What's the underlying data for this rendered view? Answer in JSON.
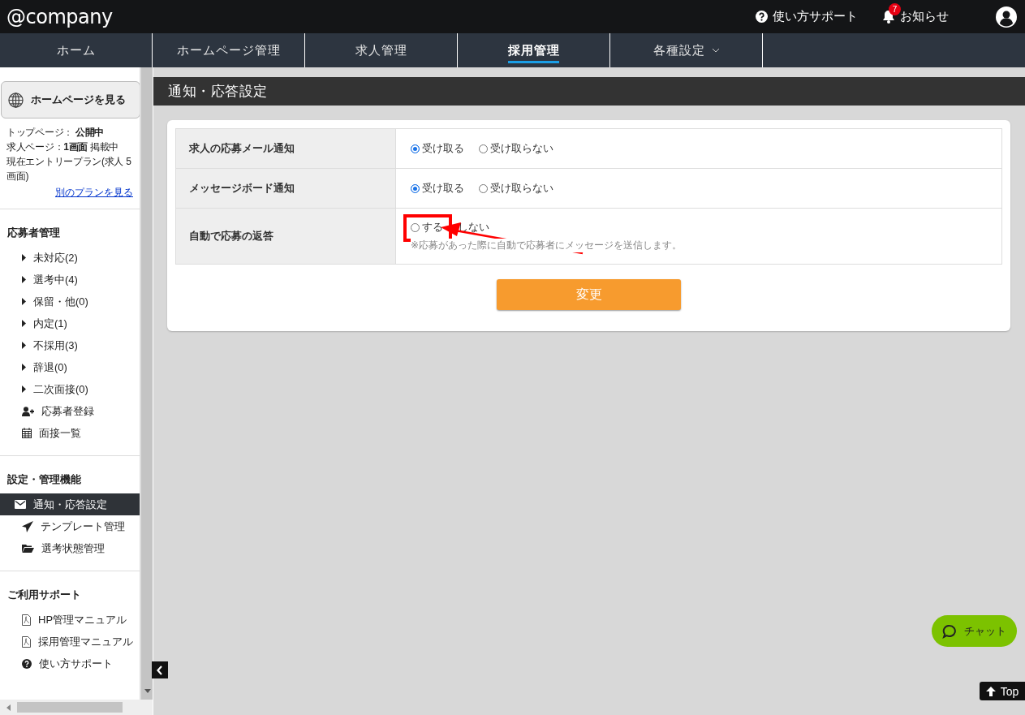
{
  "header": {
    "logo": "@company",
    "support": "使い方サポート",
    "notifications": {
      "label": "お知らせ",
      "badge": "7"
    }
  },
  "nav": [
    {
      "label": "ホーム",
      "selected": false,
      "dropdown": false
    },
    {
      "label": "ホームページ管理",
      "selected": false,
      "dropdown": false
    },
    {
      "label": "求人管理",
      "selected": false,
      "dropdown": false
    },
    {
      "label": "採用管理",
      "selected": true,
      "dropdown": false
    },
    {
      "label": "各種設定",
      "selected": false,
      "dropdown": true
    }
  ],
  "sidebar": {
    "view_button": "ホームページを見る",
    "status": [
      "トップページ： **公開中**",
      "求人ページ：**1画面** 掲載中",
      "現在エントリープラン(求人 5画面)"
    ],
    "plan_link": "別のプランを見る",
    "sections": [
      {
        "title": "応募者管理",
        "items": [
          {
            "label": "未対応(2)",
            "selected": false
          },
          {
            "label": "選考中(4)",
            "selected": false
          },
          {
            "label": "保留・他(0)",
            "selected": false
          },
          {
            "label": "内定(1)",
            "selected": false
          },
          {
            "label": "不採用(3)",
            "selected": false
          },
          {
            "label": "辞退(0)",
            "selected": false
          },
          {
            "label": "二次面接(0)",
            "selected": false
          },
          {
            "label": "応募者登録",
            "selected": false
          },
          {
            "label": "面接一覧",
            "selected": false
          }
        ]
      },
      {
        "title": "設定・管理機能",
        "items": [
          {
            "label": "通知・応答設定",
            "selected": true
          },
          {
            "label": "テンプレート管理",
            "selected": false
          },
          {
            "label": "選考状態管理",
            "selected": false
          }
        ]
      },
      {
        "title": "ご利用サポート",
        "items": [
          {
            "label": "HP管理マニュアル",
            "selected": false
          },
          {
            "label": "採用管理マニュアル",
            "selected": false
          },
          {
            "label": "使い方サポート",
            "selected": false
          }
        ]
      }
    ]
  },
  "page_title": "通知・応答設定",
  "settings": [
    {
      "label": "求人の応募メール通知",
      "options": [
        {
          "label": "受け取る",
          "selected": true
        },
        {
          "label": "受け取らない",
          "selected": false
        }
      ]
    },
    {
      "label": "メッセージボード通知",
      "options": [
        {
          "label": "受け取る",
          "selected": true
        },
        {
          "label": "受け取らない",
          "selected": false
        }
      ]
    },
    {
      "label": "自動で応募の返答",
      "options": [
        {
          "label": "する",
          "selected": false
        },
        {
          "label": "しない"
        }
      ],
      "note": "※応募があった際に自動で応募者にメッセージを送信します。"
    }
  ],
  "submit": "変更",
  "annotation": {
    "highlight_box": true,
    "arrow": true
  },
  "chat": "チャット",
  "top": "Top"
}
